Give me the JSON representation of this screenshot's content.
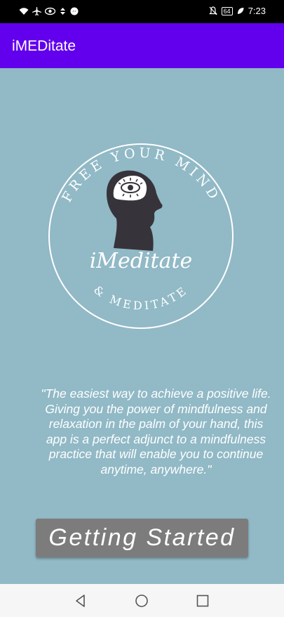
{
  "status_bar": {
    "left_icons": [
      "wifi-icon",
      "airplane-icon",
      "eye-icon",
      "data-icon",
      "messenger-icon"
    ],
    "battery": "64",
    "time": "7:23"
  },
  "app_bar": {
    "title": "iMEDitate"
  },
  "logo": {
    "arc_top": "FREE YOUR MIND",
    "script": "iMeditate",
    "arc_bottom": "& MEDITATE"
  },
  "quote": {
    "lines": [
      "\"The easiest way to achieve a positive life.",
      "Giving you the power of mindfulness and",
      "relaxation in the palm of your hand, this",
      "app is a perfect adjunct to a mindfulness",
      "practice that will enable you to continue",
      "anytime, anywhere.\""
    ]
  },
  "start_button": {
    "label": "Getting Started"
  },
  "nav": {
    "buttons": [
      "back-icon",
      "home-icon",
      "recents-icon"
    ]
  },
  "colors": {
    "background": "#91b9c6",
    "app_bar": "#6200ee",
    "button": "#7c7c7c"
  }
}
